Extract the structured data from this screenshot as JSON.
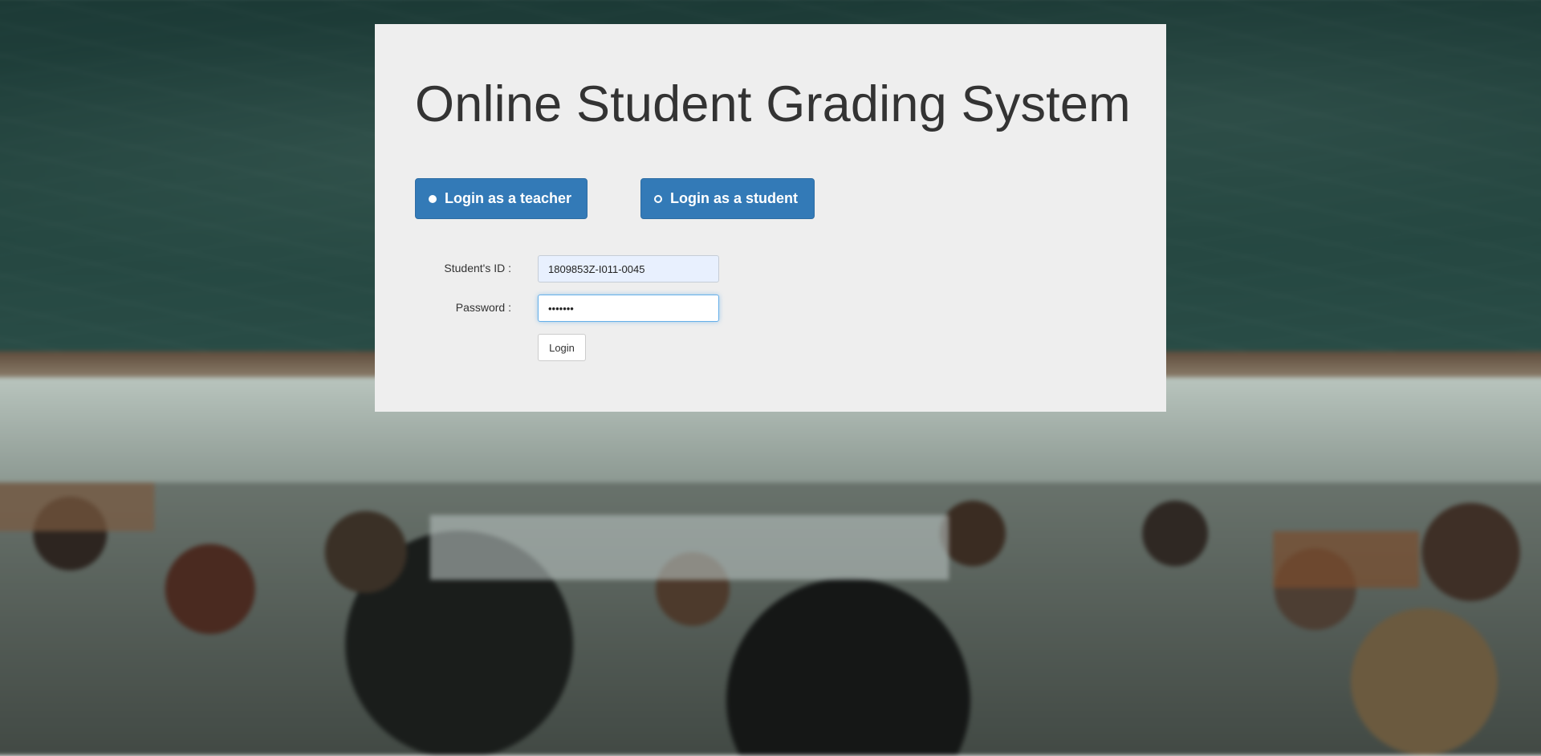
{
  "page": {
    "title": "Online Student Grading System"
  },
  "role_selector": {
    "teacher_label": "Login as a teacher",
    "student_label": "Login as a student",
    "selected": "teacher"
  },
  "form": {
    "student_id_label": "Student's ID :",
    "student_id_value": "1809853Z-I011-0045",
    "password_label": "Password :",
    "password_value": "•••••••",
    "login_label": "Login"
  },
  "colors": {
    "primary_button": "#337ab7",
    "panel_background": "#eeeeee"
  }
}
